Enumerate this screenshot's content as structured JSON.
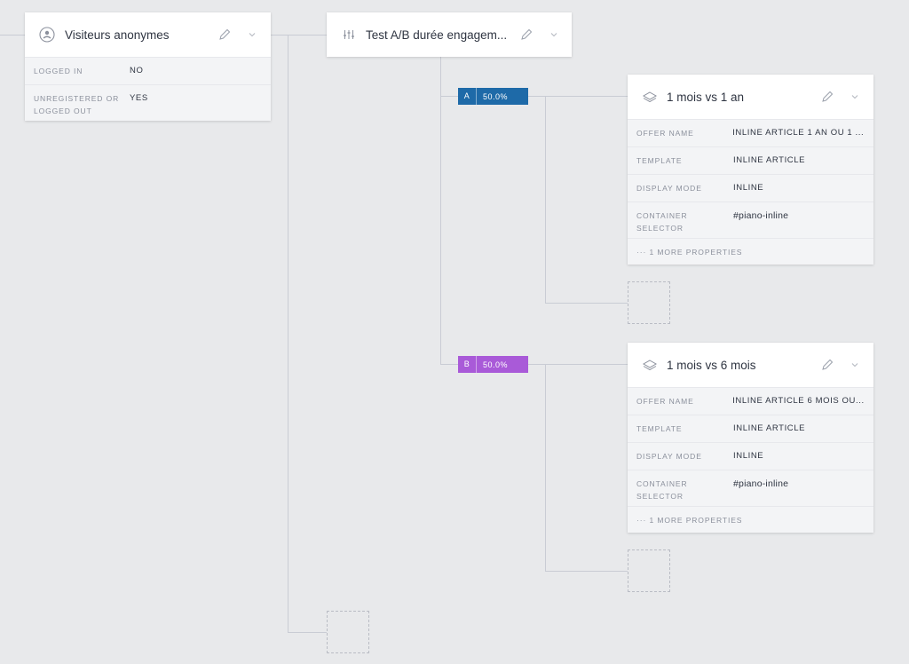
{
  "colors": {
    "background": "#e8e9eb",
    "connector": "#c9ccd4",
    "variant_a": "#1e6aa8",
    "variant_b": "#a95ad8"
  },
  "segment_card": {
    "title": "Visiteurs anonymes",
    "icon": "user-circle-icon",
    "properties": [
      {
        "key": "LOGGED IN",
        "value": "NO"
      },
      {
        "key": "UNREGISTERED OR LOGGED OUT",
        "value": "YES"
      }
    ]
  },
  "ab_test_card": {
    "title": "Test A/B durée engagem...",
    "icon": "sliders-icon"
  },
  "variants": [
    {
      "letter": "A",
      "percent": "50.0%",
      "offer_card": {
        "title": "1 mois vs 1 an",
        "icon": "layers-icon",
        "properties": [
          {
            "key": "OFFER NAME",
            "value": "INLINE ARTICLE 1 AN OU 1 ..."
          },
          {
            "key": "TEMPLATE",
            "value": "INLINE ARTICLE"
          },
          {
            "key": "DISPLAY MODE",
            "value": "INLINE"
          },
          {
            "key": "CONTAINER SELECTOR",
            "value": "#piano-inline"
          }
        ],
        "more": "··· 1 MORE PROPERTIES"
      }
    },
    {
      "letter": "B",
      "percent": "50.0%",
      "offer_card": {
        "title": "1 mois vs 6 mois",
        "icon": "layers-icon",
        "properties": [
          {
            "key": "OFFER NAME",
            "value": "INLINE ARTICLE 6 MOIS OU..."
          },
          {
            "key": "TEMPLATE",
            "value": "INLINE ARTICLE"
          },
          {
            "key": "DISPLAY MODE",
            "value": "INLINE"
          },
          {
            "key": "CONTAINER SELECTOR",
            "value": "#piano-inline"
          }
        ],
        "more": "··· 1 MORE PROPERTIES"
      }
    }
  ]
}
